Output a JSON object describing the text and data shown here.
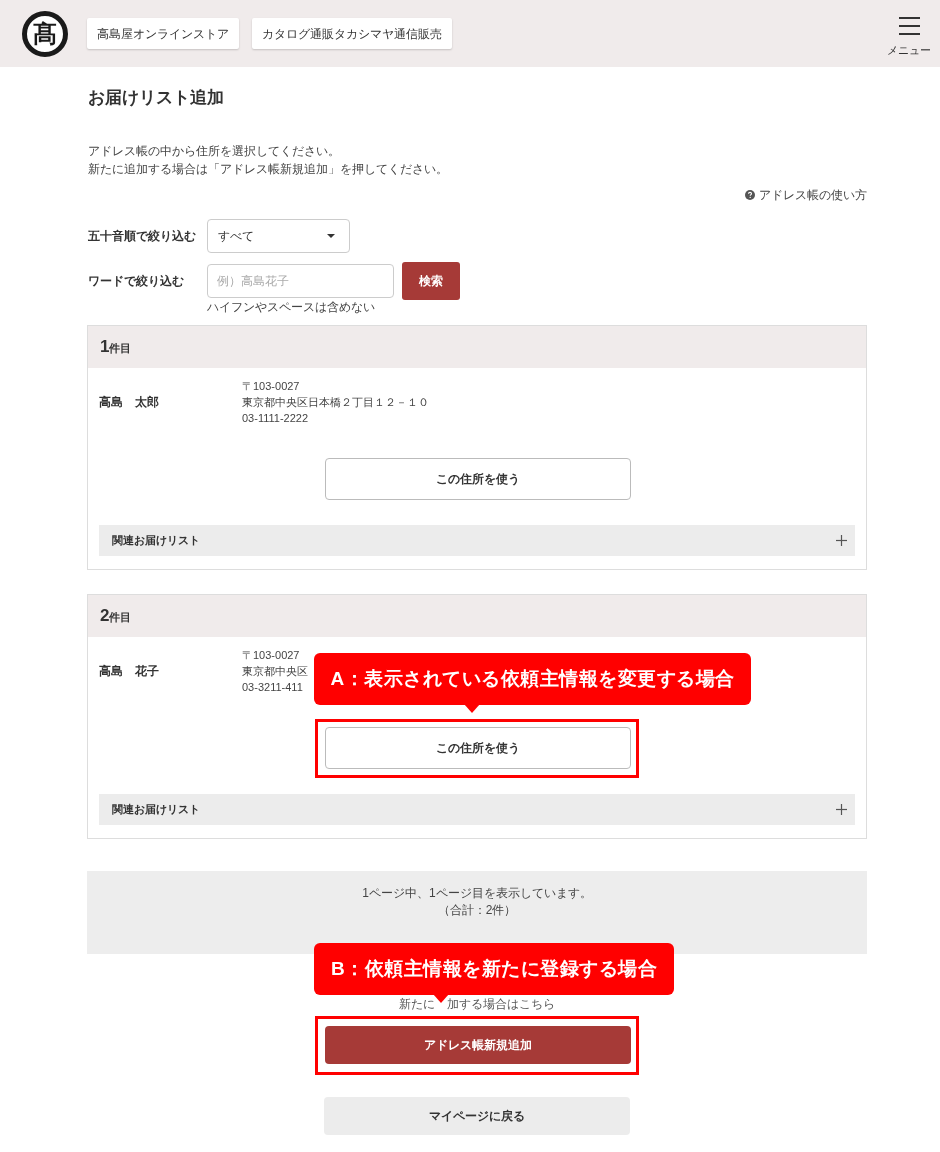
{
  "header": {
    "logo": "髙",
    "links": [
      "高島屋オンラインストア",
      "カタログ通販タカシマヤ通信販売"
    ],
    "menu_label": "メニュー"
  },
  "page": {
    "title": "お届けリスト追加",
    "instructions": [
      "アドレス帳の中から住所を選択してください。",
      "新たに追加する場合は「アドレス帳新規追加」を押してください。"
    ],
    "help_link": "アドレス帳の使い方"
  },
  "filters": {
    "kana": {
      "label": "五十音順で絞り込む",
      "value": "すべて"
    },
    "word": {
      "label": "ワードで絞り込む",
      "placeholder": "例）高島花子",
      "button": "検索",
      "hint": "ハイフンやスペースは含めない"
    }
  },
  "cards": [
    {
      "number": "1",
      "suffix": "件目",
      "name": "高島　太郎",
      "address_lines": [
        "〒103-0027",
        "東京都中央区日本橋２丁目１２－１０",
        "03-1111-2222"
      ],
      "use_button": {
        "label": "この住所を使う",
        "highlighted": false
      },
      "related": {
        "label": "関連お届けリスト",
        "expanded": false
      }
    },
    {
      "number": "2",
      "suffix": "件目",
      "name": "高島　花子",
      "address_lines": [
        "〒103-0027",
        "東京都中央区",
        "03-3211-411"
      ],
      "use_button": {
        "label": "この住所を使う",
        "highlighted": true
      },
      "callout": "A：表示されている依頼主情報を変更する場合",
      "related": {
        "label": "関連お届けリスト",
        "expanded": false
      }
    }
  ],
  "pager": [
    "1ページ中、1ページ目を表示しています。",
    "（合計：2件）"
  ],
  "new_entry": {
    "caption": [
      "新たに",
      "加する場合はこちら"
    ],
    "callout": "B：依頼主情報を新たに登録する場合",
    "button": {
      "label": "アドレス帳新規追加",
      "highlighted": true
    }
  },
  "back_button": "マイページに戻る"
}
